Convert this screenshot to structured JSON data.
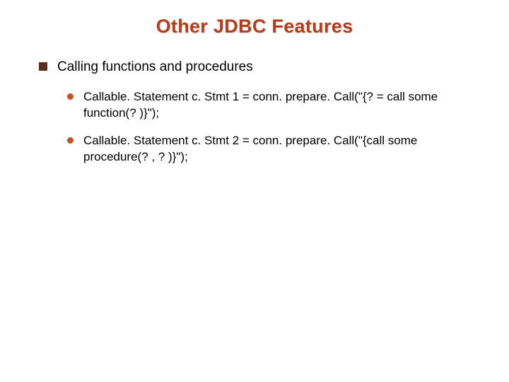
{
  "title": "Other JDBC Features",
  "level1": {
    "text": "Calling functions and procedures"
  },
  "level2": [
    {
      "text": "Callable. Statement c. Stmt 1 = conn. prepare. Call(\"{? = call some function(? )}\");"
    },
    {
      "text": "Callable. Statement c. Stmt 2 = conn. prepare. Call(\"{call some procedure(? , ? )}\");"
    }
  ]
}
